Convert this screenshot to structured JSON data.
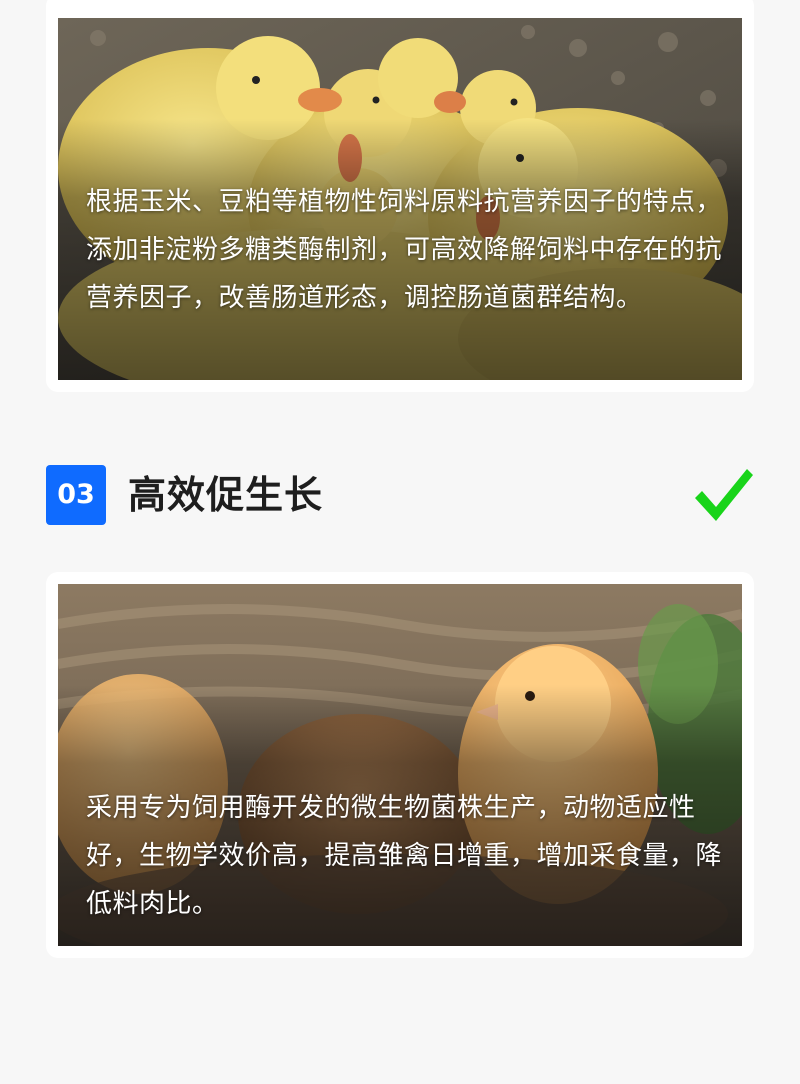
{
  "section_1": {
    "caption": "根据玉米、豆粕等植物性饲料原料抗营养因子的特点，添加非淀粉多糖类酶制剂，可高效降解饲料中存在的抗营养因子，改善肠道形态，调控肠道菌群结构。",
    "image": "ducklings-photo"
  },
  "section_2": {
    "number": "03",
    "title": "高效促生长",
    "badge_color": "#0f6bff",
    "check": "check-icon",
    "check_color": "#19d41a",
    "caption": "采用专为饲用酶开发的微生物菌株生产，动物适应性好，生物学效价高，提高雏禽日增重，增加采食量，降低料肉比。",
    "image": "chicks-photo"
  }
}
